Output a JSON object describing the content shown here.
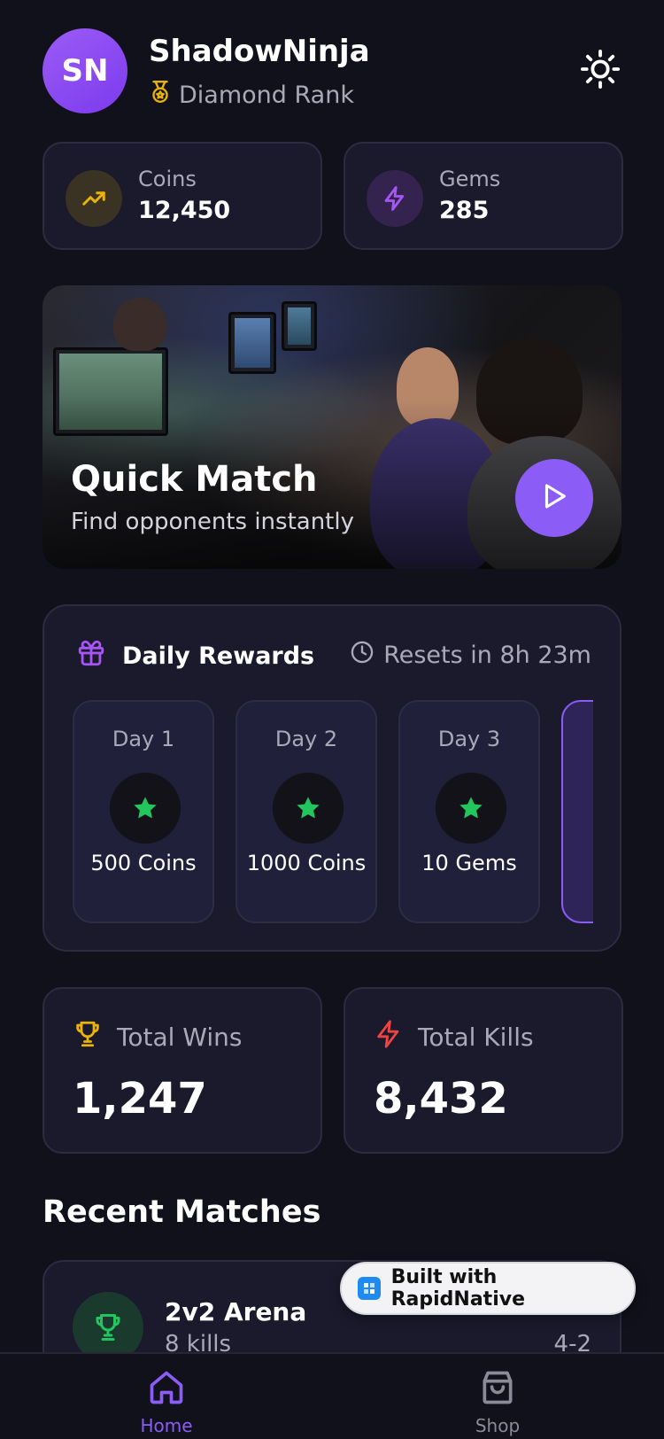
{
  "profile": {
    "initials": "SN",
    "username": "ShadowNinja",
    "rank": "Diamond Rank"
  },
  "currencies": {
    "coins": {
      "label": "Coins",
      "value": "12,450",
      "icon": "trending-up-icon"
    },
    "gems": {
      "label": "Gems",
      "value": "285",
      "icon": "lightning-icon"
    }
  },
  "hero": {
    "title": "Quick Match",
    "subtitle": "Find opponents instantly"
  },
  "daily_rewards": {
    "title": "Daily Rewards",
    "reset_text": "Resets in 8h 23m",
    "days": [
      {
        "label": "Day 1",
        "reward": "500 Coins"
      },
      {
        "label": "Day 2",
        "reward": "1000 Coins"
      },
      {
        "label": "Day 3",
        "reward": "10 Gems"
      }
    ]
  },
  "stats": {
    "wins": {
      "label": "Total Wins",
      "value": "1,247"
    },
    "kills": {
      "label": "Total Kills",
      "value": "8,432"
    }
  },
  "recent_matches": {
    "title": "Recent Matches",
    "items": [
      {
        "title": "2v2 Arena",
        "subtitle": "8 kills",
        "score": "4-2"
      }
    ]
  },
  "badge": {
    "text": "Built with RapidNative"
  },
  "nav": {
    "home": "Home",
    "shop": "Shop"
  },
  "colors": {
    "accent": "#8b5cf6",
    "background": "#11111c",
    "card": "#1a1a2c",
    "gold": "#eab308",
    "success": "#22c55e",
    "danger": "#ef4444"
  }
}
